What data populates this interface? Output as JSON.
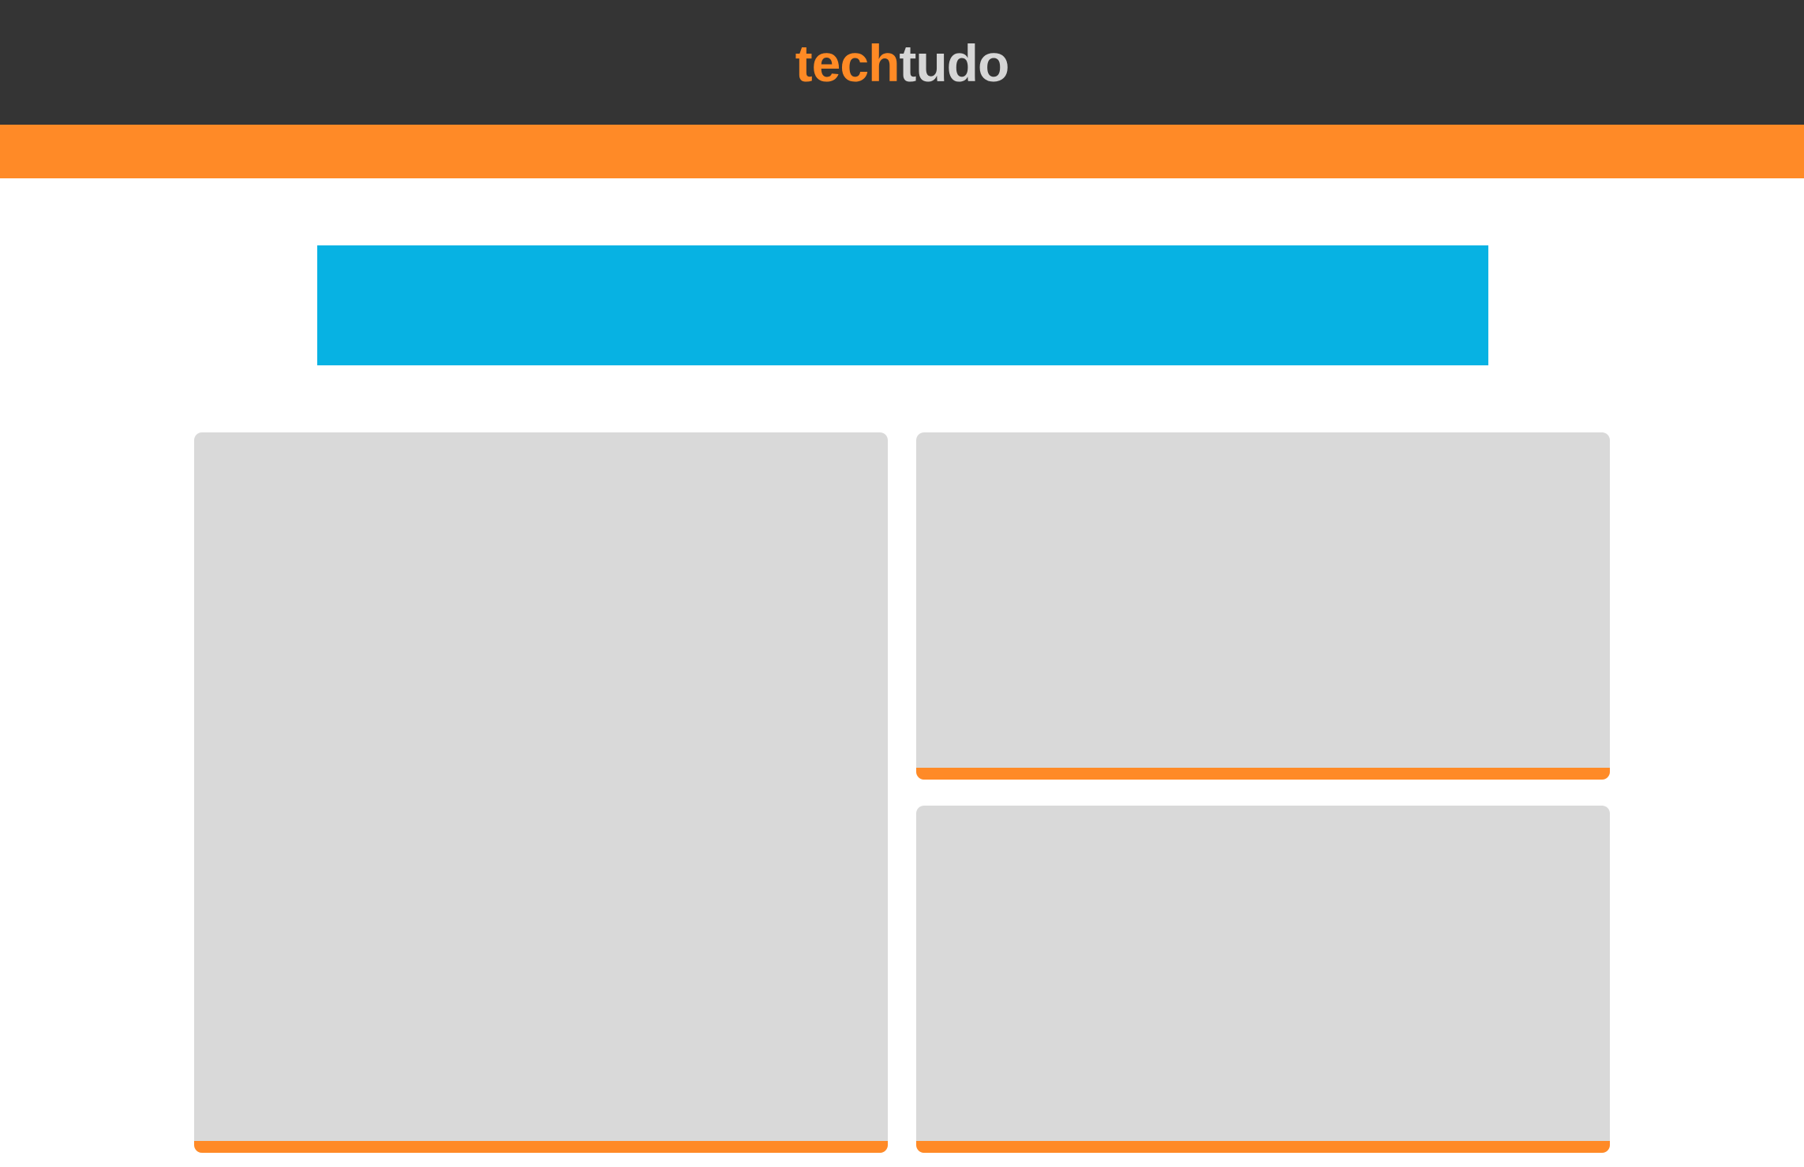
{
  "header": {
    "logo_part1": "tech",
    "logo_part2": "tudo"
  },
  "colors": {
    "topbar": "#343434",
    "accent": "#ff8a27",
    "logo_light": "#d6d6d6",
    "ad_banner": "#07b2e3",
    "card_placeholder": "#d9d9d9",
    "background": "#ffffff"
  },
  "cards": [
    {
      "slot": "featured",
      "state": "placeholder"
    },
    {
      "slot": "secondary-top",
      "state": "placeholder"
    },
    {
      "slot": "secondary-bottom",
      "state": "placeholder"
    }
  ]
}
